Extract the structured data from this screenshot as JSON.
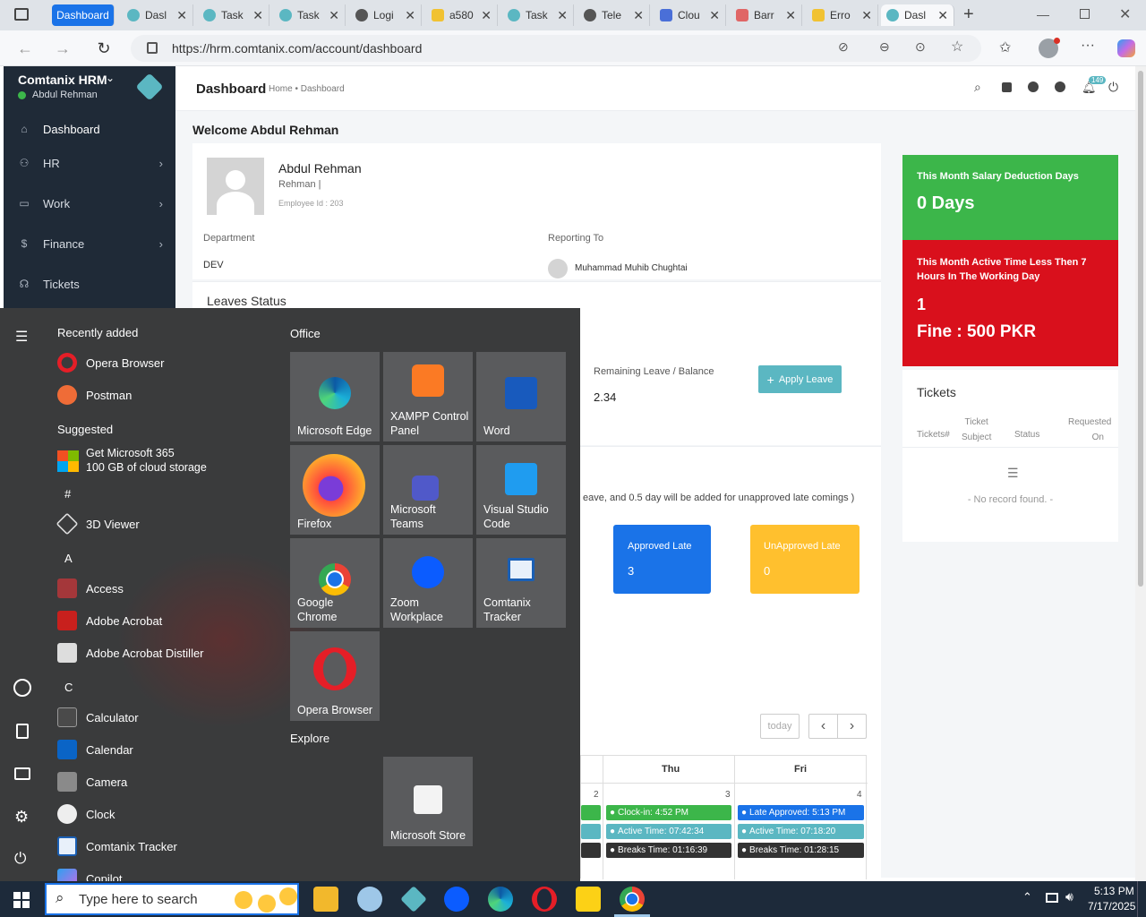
{
  "browser": {
    "tabs": [
      {
        "label": "Dashboard",
        "active": false
      },
      {
        "label": "Dasl"
      },
      {
        "label": "Task"
      },
      {
        "label": "Task"
      },
      {
        "label": "Logi"
      },
      {
        "label": "a580"
      },
      {
        "label": "Task"
      },
      {
        "label": "Tele"
      },
      {
        "label": "Clou"
      },
      {
        "label": "Barr"
      },
      {
        "label": "Erro"
      },
      {
        "label": "Dasl",
        "active": true
      }
    ],
    "url": "https://hrm.comtanix.com/account/dashboard"
  },
  "sidebar": {
    "app_name": "Comtanix HRM",
    "user": "Abdul Rehman",
    "items": [
      {
        "label": "Dashboard",
        "icon": "home-icon"
      },
      {
        "label": "HR",
        "icon": "users-icon"
      },
      {
        "label": "Work",
        "icon": "briefcase-icon"
      },
      {
        "label": "Finance",
        "icon": "dollar-icon"
      },
      {
        "label": "Tickets",
        "icon": "headset-icon"
      }
    ]
  },
  "topbar": {
    "title": "Dashboard",
    "breadcrumb_home": "Home",
    "breadcrumb_sep": "•",
    "breadcrumb_current": "Dashboard",
    "notifications": "149"
  },
  "welcome": "Welcome Abdul Rehman",
  "profile": {
    "name": "Abdul Rehman",
    "designation": "Rehman |",
    "employee_id": "Employee Id : 203",
    "department_label": "Department",
    "department": "DEV",
    "reporting_label": "Reporting To",
    "reporting_to": "Muhammad Muhib Chughtai"
  },
  "leaves": {
    "title": "Leaves Status",
    "remaining_label": "Remaining Leave / Balance",
    "remaining_value": "2.34",
    "apply_button": "Apply Leave",
    "note": "eave, and 0.5 day will be added for unapproved late comings )"
  },
  "late": {
    "approved_label": "Approved Late",
    "approved_value": "3",
    "unapproved_label": "UnApproved Late",
    "unapproved_value": "0"
  },
  "calendar": {
    "today_button": "today",
    "prev": "‹",
    "next": "›",
    "headers": [
      "Thu",
      "Fri"
    ],
    "day_numbers": [
      "2",
      "3",
      "4"
    ],
    "thu_events": [
      "Clock-in: 4:52 PM",
      "Active Time: 07:42:34",
      "Breaks Time: 01:16:39"
    ],
    "fri_events": [
      "Late Approved: 5:13 PM",
      "Active Time: 07:18:20",
      "Breaks Time: 01:28:15"
    ]
  },
  "stats": {
    "salary_label": "This Month Salary Deduction Days",
    "salary_value": "0 Days",
    "active_label": "This Month Active Time Less Then 7 Hours In The Working Day",
    "active_value": "1",
    "fine": "Fine : 500 PKR"
  },
  "tickets": {
    "title": "Tickets",
    "col1": "Tickets#",
    "col2a": "Ticket",
    "col2b": "Subject",
    "col3": "Status",
    "col4a": "Requested",
    "col4b": "On",
    "empty": "- No record found. -"
  },
  "startmenu": {
    "recently_added": "Recently added",
    "suggested": "Suggested",
    "office": "Office",
    "explore": "Explore",
    "recent": [
      "Opera Browser",
      "Postman"
    ],
    "suggest_line1": "Get Microsoft 365",
    "suggest_line2": "100 GB of cloud storage",
    "hash": "#",
    "letter_a": "A",
    "letter_c": "C",
    "apps_hash": [
      "3D Viewer"
    ],
    "apps_a": [
      "Access",
      "Adobe Acrobat",
      "Adobe Acrobat Distiller"
    ],
    "apps_c": [
      "Calculator",
      "Calendar",
      "Camera",
      "Clock",
      "Comtanix Tracker",
      "Copilot"
    ],
    "tiles": [
      {
        "name": "Microsoft Edge"
      },
      {
        "name": "XAMPP Control Panel"
      },
      {
        "name": "Word"
      },
      {
        "name": "Firefox"
      },
      {
        "name": "Microsoft Teams"
      },
      {
        "name": "Visual Studio Code"
      },
      {
        "name": "Google Chrome"
      },
      {
        "name": "Zoom Workplace"
      },
      {
        "name": "Comtanix Tracker"
      },
      {
        "name": "Opera Browser"
      }
    ],
    "explore_tile": "Microsoft Store"
  },
  "taskbar": {
    "search_placeholder": "Type here to search",
    "time": "5:13 PM",
    "date": "7/17/2025"
  },
  "colors": {
    "green": "#3cb64a",
    "red": "#d9101c",
    "blue": "#1a73e8",
    "yellow": "#ffc02e",
    "teal": "#5bb7c2",
    "sidebar": "#1f2a37"
  }
}
